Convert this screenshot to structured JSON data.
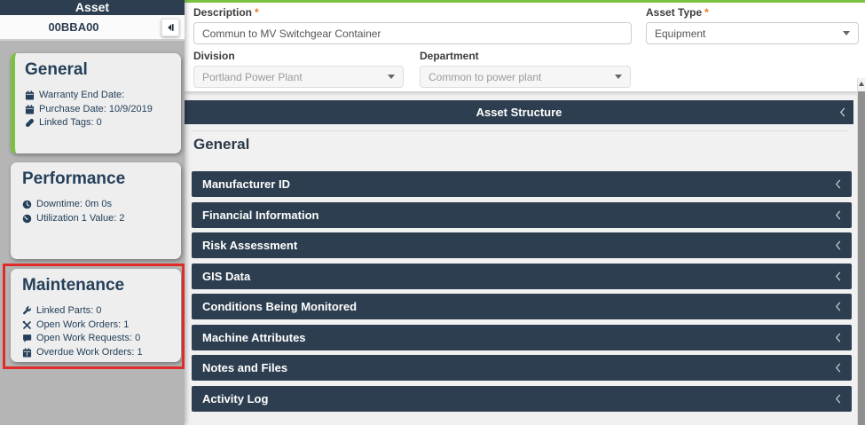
{
  "colors": {
    "navy": "#2d3e50",
    "accent_green": "#7cc242",
    "annotation_red": "#e02b2b",
    "required_asterisk": "#e8791e",
    "sidebar_gray": "#b5b5b5"
  },
  "sidebar": {
    "header_title": "Asset",
    "asset_id": "00BBA00",
    "collapse_icon": "collapse-left-icon",
    "cards": [
      {
        "title": "General",
        "accent": "green",
        "items": [
          {
            "icon": "calendar-icon",
            "text": "Warranty End Date:"
          },
          {
            "icon": "calendar-icon",
            "text": "Purchase Date: 10/9/2019"
          },
          {
            "icon": "link-icon",
            "text": "Linked Tags: 0"
          }
        ]
      },
      {
        "title": "Performance",
        "items": [
          {
            "icon": "clock-icon",
            "text": "Downtime: 0m 0s"
          },
          {
            "icon": "gauge-icon",
            "text": "Utilization 1 Value: 2"
          }
        ]
      },
      {
        "title": "Maintenance",
        "highlighted": true,
        "items": [
          {
            "icon": "wrench-icon",
            "text": "Linked Parts: 0"
          },
          {
            "icon": "tools-icon",
            "text": "Open Work Orders: 1"
          },
          {
            "icon": "comment-icon",
            "text": "Open Work Requests: 0"
          },
          {
            "icon": "calendar-alert-icon",
            "text": "Overdue Work Orders: 1"
          }
        ]
      }
    ]
  },
  "form": {
    "required_marker": "*",
    "fields": {
      "description": {
        "label": "Description",
        "required": true,
        "value": "Commun to MV Switchgear Container"
      },
      "asset_type": {
        "label": "Asset Type",
        "required": true,
        "value": "Equipment"
      },
      "division": {
        "label": "Division",
        "required": false,
        "value": "Portland Power Plant"
      },
      "department": {
        "label": "Department",
        "required": false,
        "value": "Common to power plant"
      }
    }
  },
  "structure": {
    "panel_title": "Asset Structure",
    "group_heading": "General",
    "sections": [
      {
        "label": "Manufacturer ID"
      },
      {
        "label": "Financial Information"
      },
      {
        "label": "Risk Assessment"
      },
      {
        "label": "GIS Data"
      },
      {
        "label": "Conditions Being Monitored"
      },
      {
        "label": "Machine Attributes"
      },
      {
        "label": "Notes and Files"
      },
      {
        "label": "Activity Log"
      }
    ]
  }
}
